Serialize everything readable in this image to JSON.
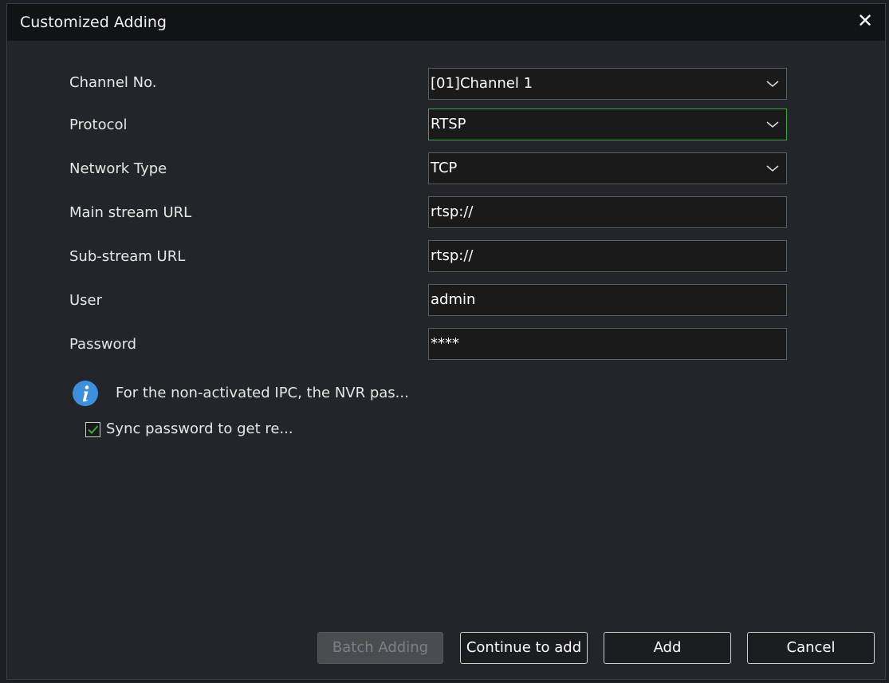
{
  "dialog": {
    "title": "Customized Adding",
    "close_icon": "close-icon"
  },
  "form": {
    "channel_no": {
      "label": "Channel No.",
      "value": "[01]Channel 1"
    },
    "protocol": {
      "label": "Protocol",
      "value": "RTSP"
    },
    "network_type": {
      "label": "Network Type",
      "value": "TCP"
    },
    "main_stream_url": {
      "label": "Main stream URL",
      "value": "rtsp://"
    },
    "sub_stream_url": {
      "label": "Sub-stream URL",
      "value": "rtsp://"
    },
    "user": {
      "label": "User",
      "value": "admin"
    },
    "password": {
      "label": "Password",
      "value": "****"
    }
  },
  "info": {
    "icon": "info-icon",
    "text": "For the non-activated IPC, the NVR pas..."
  },
  "sync": {
    "checked": true,
    "label": "Sync password to get re..."
  },
  "buttons": {
    "batch_adding": "Batch Adding",
    "continue_to_add": "Continue to add",
    "add": "Add",
    "cancel": "Cancel"
  },
  "colors": {
    "title_bar": "#111316",
    "dialog_bg": "#22262b",
    "focus_border": "#3fa843",
    "info_icon": "#3e8fdc",
    "check_mark": "#3fa843"
  }
}
